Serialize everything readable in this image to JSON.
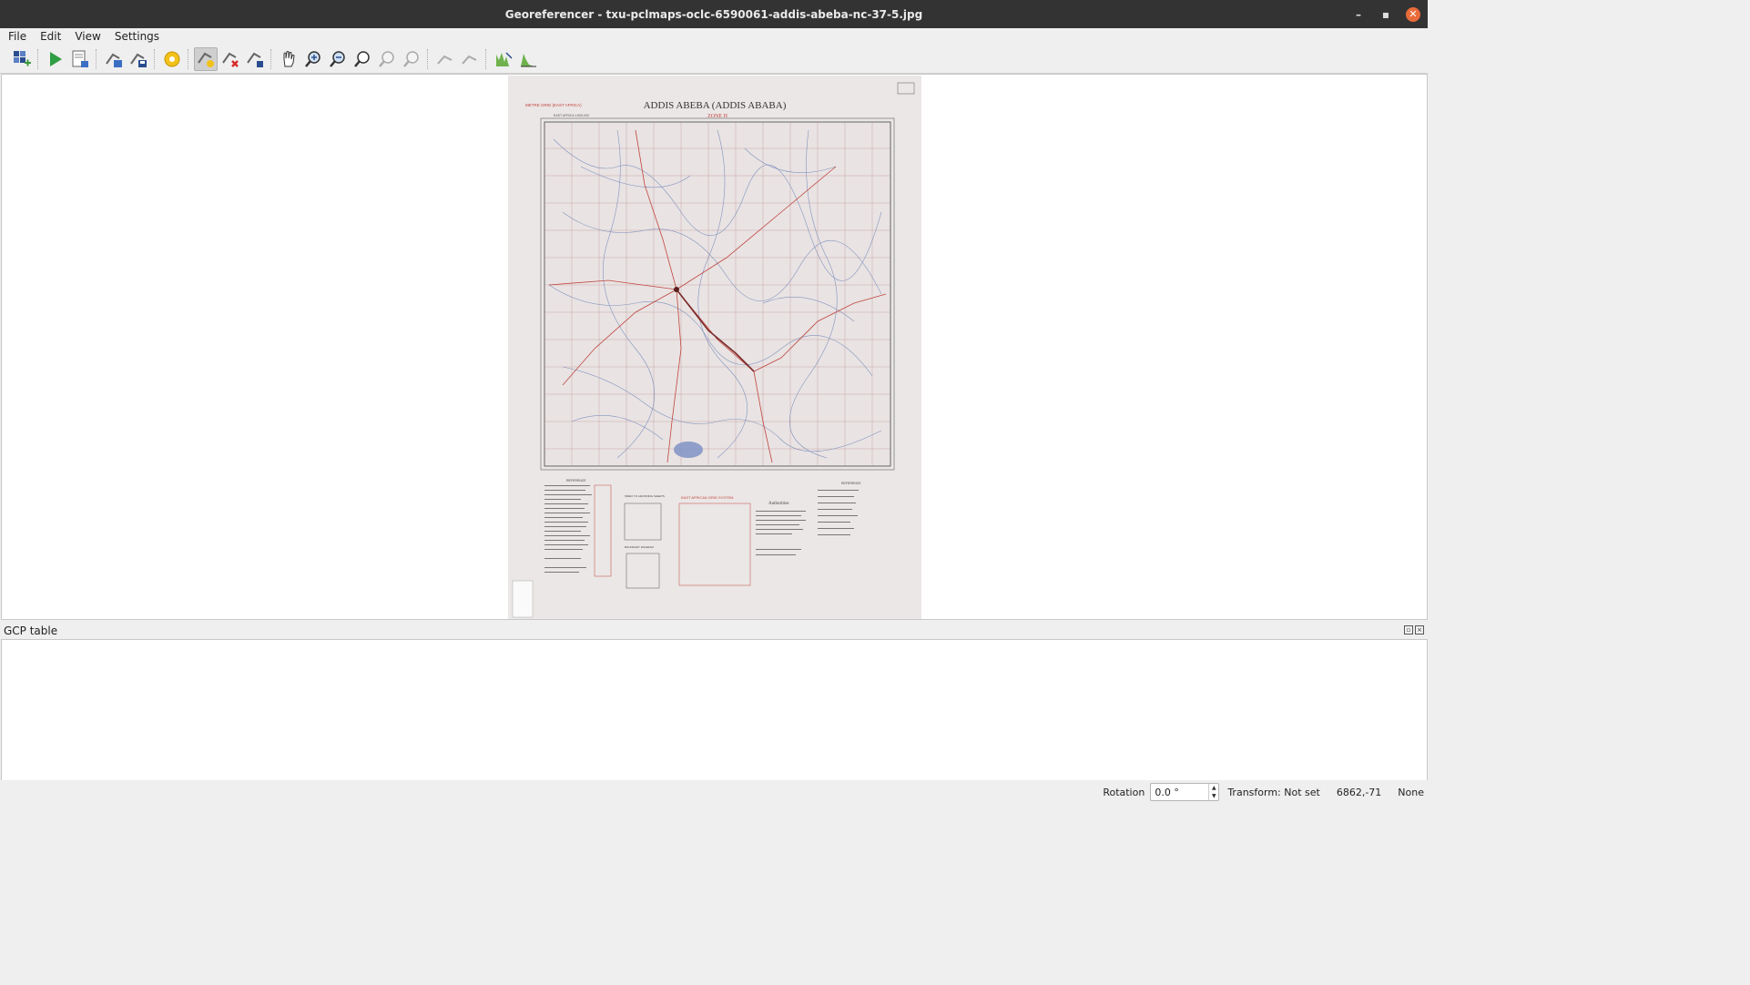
{
  "window": {
    "title": "Georeferencer - txu-pclmaps-oclc-6590061-addis-abeba-nc-37-5.jpg",
    "minimize_label": "–",
    "maximize_label": "▪",
    "close_label": "✕"
  },
  "menu": {
    "items": [
      "File",
      "Edit",
      "View",
      "Settings"
    ]
  },
  "toolbar": {
    "icons": [
      "open-raster-icon",
      "start-georeferencing-icon",
      "generate-gdal-script-icon",
      "load-gcp-points-icon",
      "save-gcp-points-icon",
      "transformation-settings-icon",
      "add-point-icon",
      "delete-point-icon",
      "move-gcp-point-icon",
      "pan-icon",
      "zoom-in-icon",
      "zoom-out-icon",
      "zoom-to-layer-icon",
      "zoom-last-icon",
      "zoom-next-icon",
      "link-georeferencer-to-qgis-icon",
      "link-qgis-to-georeferencer-icon",
      "full-histogram-stretch-icon",
      "local-histogram-stretch-icon"
    ]
  },
  "map": {
    "title": "ADDIS ABEBA (ADDIS ABABA)",
    "subtitle": "ZONE H",
    "series": "METRE GRID (EAST AFRICA)",
    "scale_note": "EAST AFRICA 1:500,000",
    "grid_legend_title": "EAST AFRICAN GRID SYSTEM",
    "authorities_title": "Authorities",
    "reference_title": "REFERENCE",
    "boundary_title": "BOUNDARY DIAGRAM",
    "index_title": "INDEX TO ADJOINING SHEETS"
  },
  "gcp_panel": {
    "title": "GCP table"
  },
  "statusbar": {
    "rotation_label": "Rotation",
    "rotation_value": "0.0 °",
    "transform_text": "Transform: Not set",
    "coordinates": "6862,-71",
    "crs_text": "None"
  },
  "colors": {
    "titlebar": "#333333",
    "close_button": "#e96b3a",
    "map_paper": "#ebe7e6",
    "map_red": "#c0453e",
    "map_blue": "#6f86b8"
  }
}
